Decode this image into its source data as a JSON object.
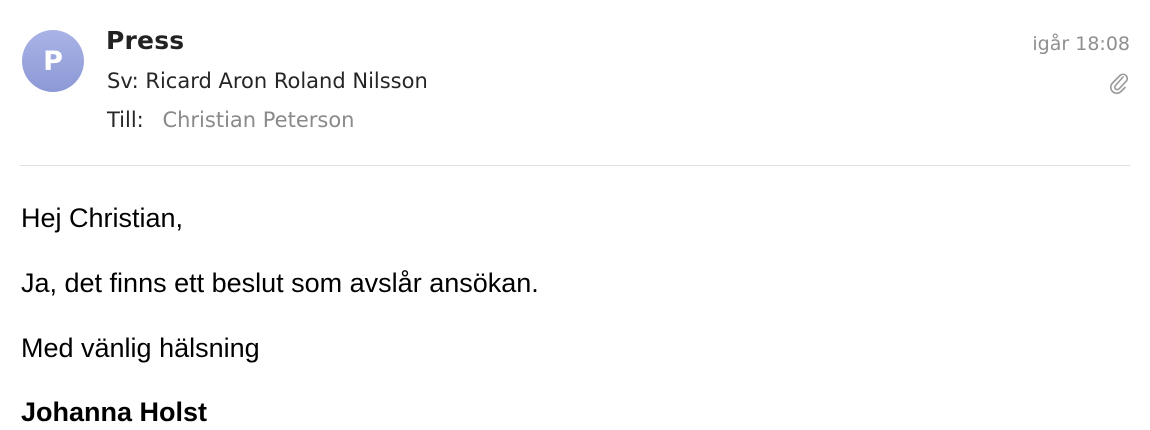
{
  "header": {
    "avatar_letter": "P",
    "sender": "Press",
    "subject": "Sv: Ricard Aron Roland Nilsson",
    "to_label": "Till:",
    "to_name": "Christian Peterson",
    "date": "igår 18:08",
    "attachment_icon": "paperclip-icon"
  },
  "body": {
    "greeting": "Hej Christian,",
    "message": "Ja, det finns ett beslut som avslår ansökan.",
    "closing": "Med vänlig hälsning",
    "signature": "Johanna Holst"
  },
  "colors": {
    "avatar": "#9aa5de",
    "muted_text": "#8a8a8a",
    "divider": "#e0e0e0"
  }
}
